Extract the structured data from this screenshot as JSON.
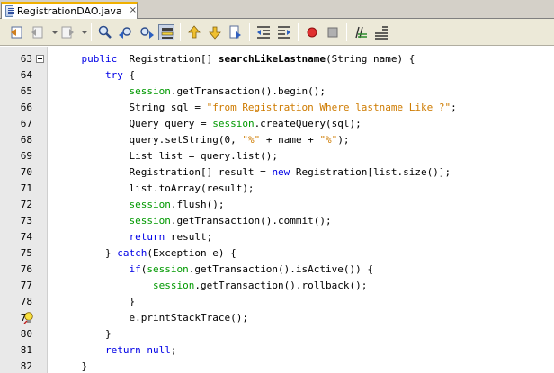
{
  "tab": {
    "label": "RegistrationDAO.java",
    "close": "×"
  },
  "toolbar": {
    "buttons": [
      "last-edit-icon",
      "back-icon",
      "forward-icon",
      "find-icon",
      "find-previous-icon",
      "find-next-icon",
      "toggle-highlight-icon",
      "previous-bookmark-icon",
      "next-bookmark-icon",
      "toggle-bookmark-icon",
      "shift-left-icon",
      "shift-right-icon",
      "start-macro-icon",
      "stop-macro-icon",
      "comment-icon",
      "uncomment-icon"
    ]
  },
  "editor": {
    "lines": [
      {
        "n": "63",
        "indent": "    ",
        "parts": [
          [
            "kw",
            "public"
          ],
          [
            "",
            "  Registration[] "
          ],
          [
            "bold",
            "searchLikeLastname"
          ],
          [
            "",
            "(String name) {"
          ]
        ]
      },
      {
        "n": "64",
        "indent": "        ",
        "parts": [
          [
            "kw",
            "try"
          ],
          [
            "",
            " {"
          ]
        ]
      },
      {
        "n": "65",
        "indent": "            ",
        "parts": [
          [
            "fld",
            "session"
          ],
          [
            "",
            ".getTransaction().begin();"
          ]
        ]
      },
      {
        "n": "66",
        "indent": "            ",
        "parts": [
          [
            "",
            "String sql = "
          ],
          [
            "str",
            "\"from Registration Where lastname Like ?\""
          ],
          [
            "",
            ";"
          ]
        ]
      },
      {
        "n": "67",
        "indent": "            ",
        "parts": [
          [
            "",
            "Query query = "
          ],
          [
            "fld",
            "session"
          ],
          [
            "",
            ".createQuery(sql);"
          ]
        ]
      },
      {
        "n": "68",
        "indent": "            ",
        "parts": [
          [
            "",
            "query.setString(0, "
          ],
          [
            "str",
            "\"%\""
          ],
          [
            "",
            " + name + "
          ],
          [
            "str",
            "\"%\""
          ],
          [
            "",
            ");"
          ]
        ]
      },
      {
        "n": "69",
        "indent": "            ",
        "parts": [
          [
            "",
            "List list = query.list();"
          ]
        ]
      },
      {
        "n": "70",
        "indent": "            ",
        "parts": [
          [
            "",
            "Registration[] result = "
          ],
          [
            "kw",
            "new"
          ],
          [
            "",
            " Registration[list.size()];"
          ]
        ]
      },
      {
        "n": "71",
        "indent": "            ",
        "parts": [
          [
            "",
            "list.toArray(result);"
          ]
        ]
      },
      {
        "n": "72",
        "indent": "            ",
        "parts": [
          [
            "fld",
            "session"
          ],
          [
            "",
            ".flush();"
          ]
        ]
      },
      {
        "n": "73",
        "indent": "            ",
        "parts": [
          [
            "fld",
            "session"
          ],
          [
            "",
            ".getTransaction().commit();"
          ]
        ]
      },
      {
        "n": "74",
        "indent": "            ",
        "parts": [
          [
            "kw",
            "return"
          ],
          [
            "",
            " result;"
          ]
        ]
      },
      {
        "n": "75",
        "indent": "        ",
        "parts": [
          [
            "",
            "} "
          ],
          [
            "kw",
            "catch"
          ],
          [
            "",
            "(Exception e) {"
          ]
        ]
      },
      {
        "n": "76",
        "indent": "            ",
        "parts": [
          [
            "kw",
            "if"
          ],
          [
            "",
            "("
          ],
          [
            "fld",
            "session"
          ],
          [
            "",
            ".getTransaction().isActive()) {"
          ]
        ]
      },
      {
        "n": "77",
        "indent": "                ",
        "parts": [
          [
            "fld",
            "session"
          ],
          [
            "",
            ".getTransaction().rollback();"
          ]
        ]
      },
      {
        "n": "78",
        "indent": "            ",
        "parts": [
          [
            "",
            "}"
          ]
        ]
      },
      {
        "n": "79",
        "indent": "            ",
        "parts": [
          [
            "",
            "e.printStackTrace();"
          ]
        ]
      },
      {
        "n": "80",
        "indent": "        ",
        "parts": [
          [
            "",
            "}"
          ]
        ]
      },
      {
        "n": "81",
        "indent": "        ",
        "parts": [
          [
            "kw",
            "return"
          ],
          [
            "",
            ""
          ],
          [
            "kw",
            " null"
          ],
          [
            "",
            ";"
          ]
        ]
      },
      {
        "n": "82",
        "indent": "    ",
        "parts": [
          [
            "",
            "}"
          ]
        ]
      }
    ]
  }
}
